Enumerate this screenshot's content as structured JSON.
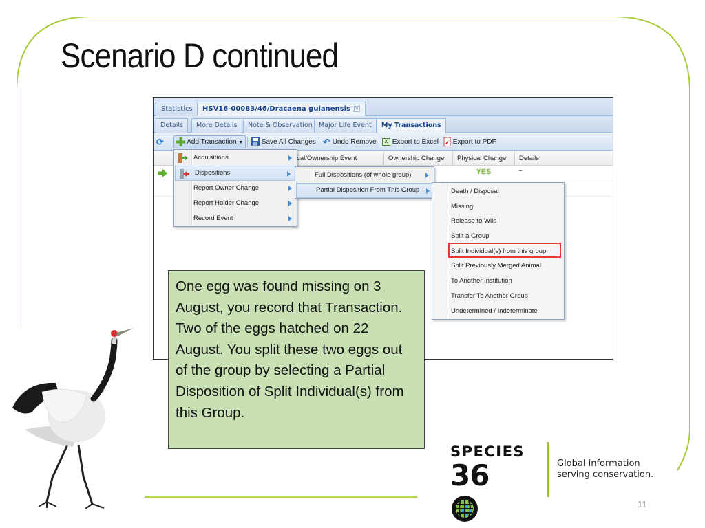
{
  "slide": {
    "title": "Scenario D continued",
    "page_number": "11",
    "accent_color": "#a8cc3c"
  },
  "app": {
    "top_tabs": [
      {
        "label": "Statistics",
        "active": false
      },
      {
        "label": "HSV16-00083/46/Dracaena guianensis",
        "active": true,
        "closable": true
      }
    ],
    "sub_tabs": [
      {
        "label": "Details",
        "active": false
      },
      {
        "label": "More Details",
        "active": false
      },
      {
        "label": "Note & Observation",
        "active": false
      },
      {
        "label": "Major Life Event",
        "active": false
      },
      {
        "label": "My Transactions",
        "active": true
      }
    ],
    "toolbar": {
      "refresh_icon": "refresh-icon",
      "add_transaction": "Add Transaction",
      "save_all_changes": "Save All Changes",
      "undo_remove": "Undo Remove",
      "export_excel": "Export to Excel",
      "export_pdf": "Export to PDF"
    },
    "grid": {
      "columns": [
        "ical/Ownership Event",
        "Ownership Change",
        "Physical Change",
        "Details"
      ],
      "rows": [
        {
          "physical_change": "YES",
          "details": "~"
        }
      ]
    },
    "menu_level1": [
      {
        "label": "Acquisitions",
        "icon": "acquisition-door-icon",
        "has_submenu": true
      },
      {
        "label": "Dispositions",
        "icon": "disposition-door-icon",
        "has_submenu": true,
        "highlighted": true
      },
      {
        "label": "Report Owner Change",
        "has_submenu": true
      },
      {
        "label": "Report Holder Change",
        "has_submenu": true
      },
      {
        "label": "Record Event",
        "has_submenu": true
      }
    ],
    "menu_level2": [
      {
        "label": "Full Dispositions (of whole group)",
        "has_submenu": true
      },
      {
        "label": "Partial Disposition From This Group",
        "has_submenu": true,
        "highlighted": true
      }
    ],
    "menu_level3": [
      {
        "label": "Death / Disposal"
      },
      {
        "label": "Missing"
      },
      {
        "label": "Release to Wild"
      },
      {
        "label": "Split a Group"
      },
      {
        "label": "Split Individual(s) from this group",
        "boxed": true
      },
      {
        "label": "Split Previously Merged Animal"
      },
      {
        "label": "To Another Institution"
      },
      {
        "label": "Transfer To Another Group"
      },
      {
        "label": "Undetermined / Indeterminate"
      }
    ]
  },
  "callout": {
    "text": "One egg was found missing on 3 August, you record that Transaction. Two of the eggs hatched on 22 August. You split these two eggs out of the group by selecting a Partial Disposition of Split Individual(s) from this Group."
  },
  "logo": {
    "line1": "SPECIES",
    "line2": "36",
    "tagline_line1": "Global information",
    "tagline_line2": "serving conservation."
  }
}
